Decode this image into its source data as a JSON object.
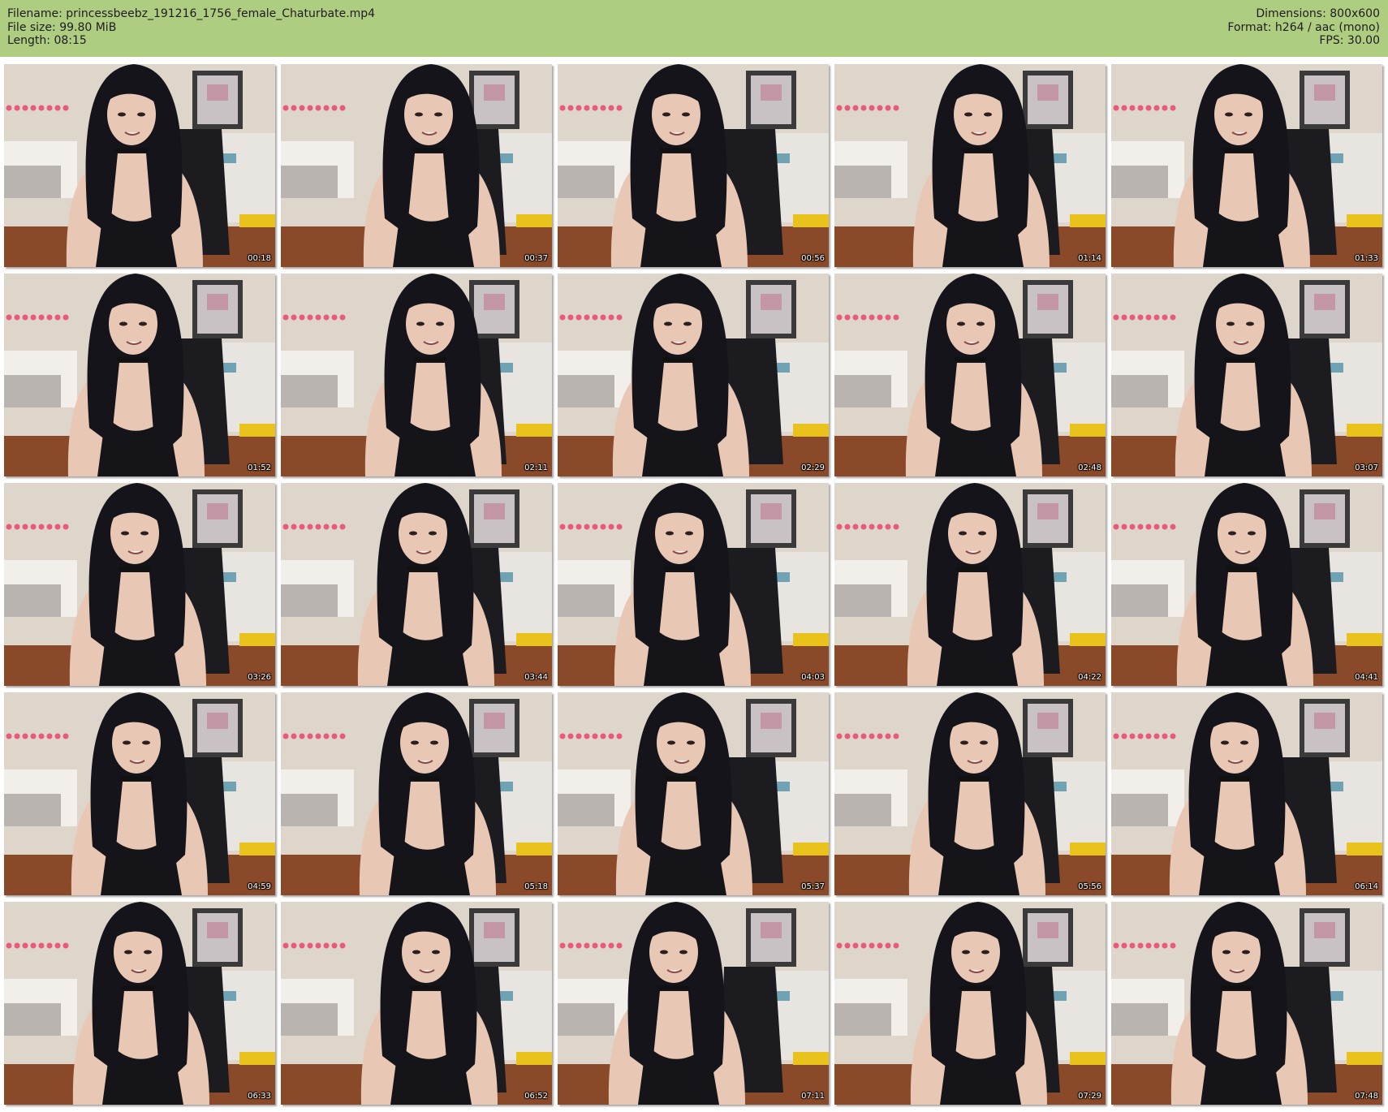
{
  "header": {
    "filename_line": "Filename: princessbeebz_191216_1756_female_Chaturbate.mp4",
    "filesize_line": "File size: 99.80 MiB",
    "length_line": "Length: 08:15",
    "dimensions_line": "Dimensions: 800x600",
    "format_line": "Format: h264 / aac (mono)",
    "fps_line": "FPS: 30.00"
  },
  "colors": {
    "header_bg": "#afcd80",
    "wall": "#ded6cb",
    "hair": "#15141a",
    "skin": "#e8c8b4",
    "top": "#151419",
    "floor": "#8a4a2a",
    "lights": "#e85a7a"
  },
  "thumbnails": [
    {
      "timestamp": "00:18"
    },
    {
      "timestamp": "00:37"
    },
    {
      "timestamp": "00:56"
    },
    {
      "timestamp": "01:14"
    },
    {
      "timestamp": "01:33"
    },
    {
      "timestamp": "01:52"
    },
    {
      "timestamp": "02:11"
    },
    {
      "timestamp": "02:29"
    },
    {
      "timestamp": "02:48"
    },
    {
      "timestamp": "03:07"
    },
    {
      "timestamp": "03:26"
    },
    {
      "timestamp": "03:44"
    },
    {
      "timestamp": "04:03"
    },
    {
      "timestamp": "04:22"
    },
    {
      "timestamp": "04:41"
    },
    {
      "timestamp": "04:59"
    },
    {
      "timestamp": "05:18"
    },
    {
      "timestamp": "05:37"
    },
    {
      "timestamp": "05:56"
    },
    {
      "timestamp": "06:14"
    },
    {
      "timestamp": "06:33"
    },
    {
      "timestamp": "06:52"
    },
    {
      "timestamp": "07:11"
    },
    {
      "timestamp": "07:29"
    },
    {
      "timestamp": "07:48"
    }
  ]
}
